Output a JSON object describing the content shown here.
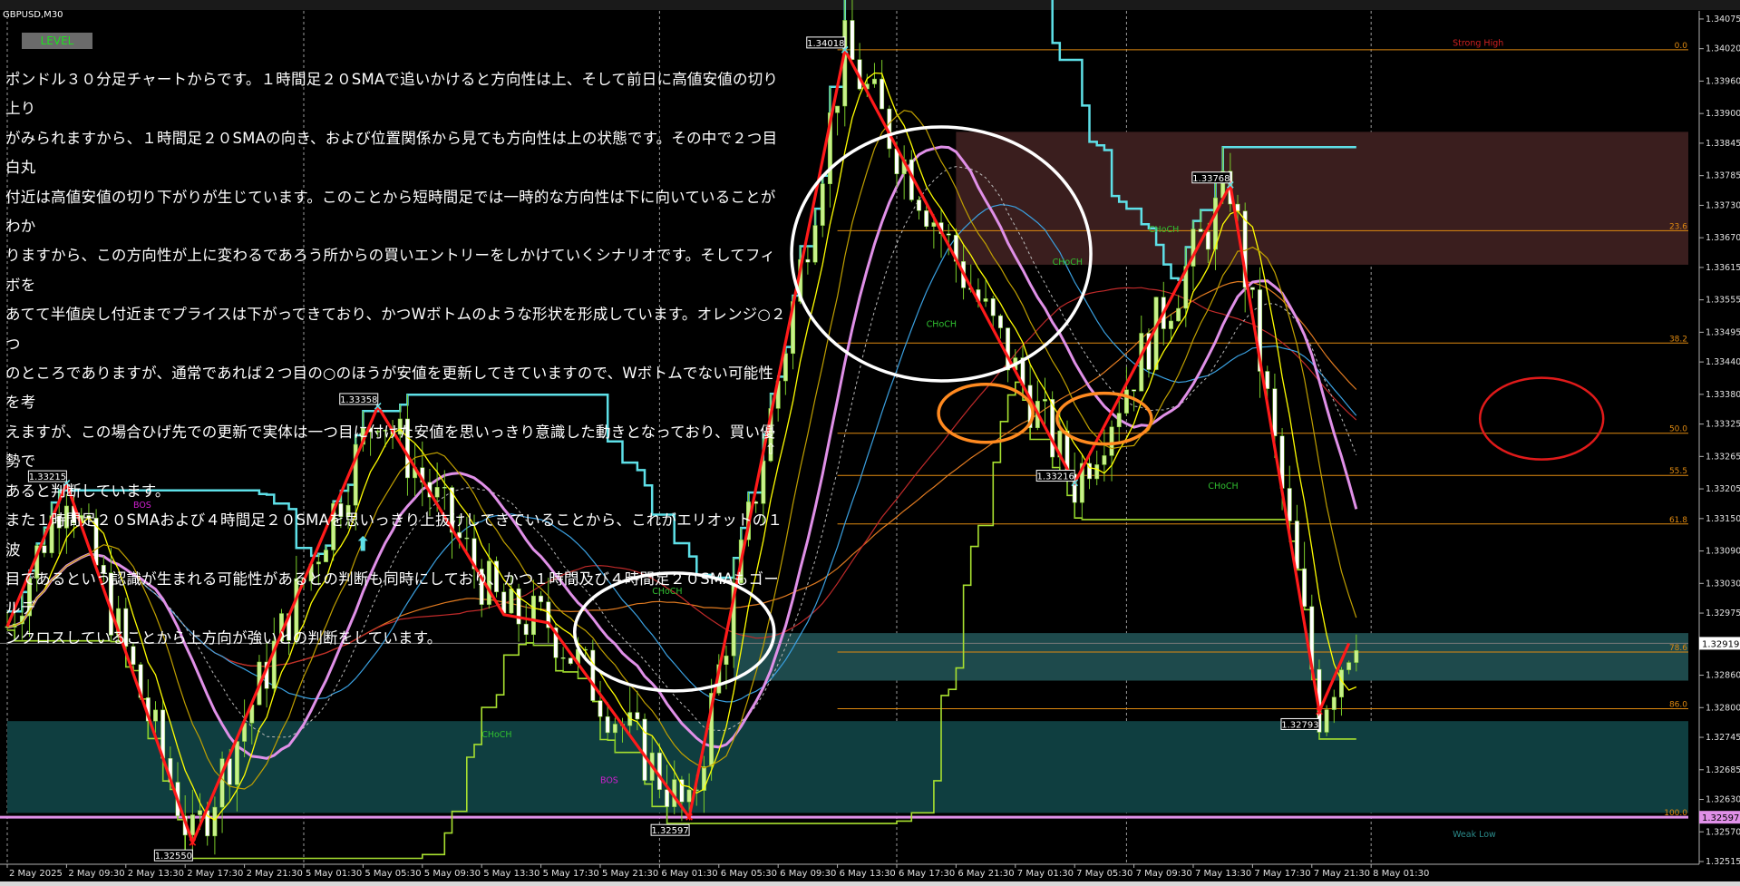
{
  "window": {
    "title": "GBPUSD,M30"
  },
  "level_button": {
    "label": "LEVEL"
  },
  "comment_lines": [
    "ポンドル３０分足チャートからです。１時間足２０SMAで追いかけると方向性は上、そして前日に高値安値の切り上り",
    "がみられますから、１時間足２０SMAの向き、および位置関係から見ても方向性は上の状態です。その中で２つ目白丸",
    "付近は高値安値の切り下がりが生じています。このことから短時間足では一時的な方向性は下に向いていることがわか",
    "りますから、この方向性が上に変わるであろう所からの買いエントリーをしかけていくシナリオです。そしてフィボを",
    "あてて半値戻し付近までプライスは下がってきており、かつWボトムのような形状を形成しています。オレンジ○２つ",
    "のところでありますが、通常であれば２つ目の○のほうが安値を更新してきていますので、Wボトムでない可能性を考",
    "えますが、この場合ひげ先での更新で実体は一つ目に付けた安値を思いっきり意識した動きとなっており、買い優勢で",
    "あると判断しています。",
    "また１時間足２０SMAおよび４時間足２０SMAを思いっきり上抜けしてきていることから、これがエリオットの１波",
    "目であるという認識が生まれる可能性があるとの判断も同時にしており、かつ１時間及び４時間足２０SMAもゴールデ",
    "ンクロスしていることから上方向が強いとの判断をしています。"
  ],
  "chart_data": {
    "type": "line",
    "symbol": "GBPUSD",
    "timeframe": "M30",
    "ylim": [
      1.3251,
      1.3409
    ],
    "x_tick_labels": [
      "2 May 2025",
      "2 May 09:30",
      "2 May 13:30",
      "2 May 17:30",
      "2 May 21:30",
      "5 May 01:30",
      "5 May 05:30",
      "5 May 09:30",
      "5 May 13:30",
      "5 May 17:30",
      "5 May 21:30",
      "6 May 01:30",
      "6 May 05:30",
      "6 May 09:30",
      "6 May 13:30",
      "6 May 17:30",
      "6 May 21:30",
      "7 May 01:30",
      "7 May 05:30",
      "7 May 09:30",
      "7 May 13:30",
      "7 May 17:30",
      "7 May 21:30",
      "8 May 01:30"
    ],
    "y_tick_labels": [
      "1.34075",
      "1.34020",
      "1.33960",
      "1.33900",
      "1.33845",
      "1.33785",
      "1.33730",
      "1.33670",
      "1.33615",
      "1.33555",
      "1.33495",
      "1.33440",
      "1.33380",
      "1.33325",
      "1.33265",
      "1.33205",
      "1.33150",
      "1.33090",
      "1.33030",
      "1.32975",
      "1.32915",
      "1.32860",
      "1.32800",
      "1.32745",
      "1.32685",
      "1.32630",
      "1.32570",
      "1.32515"
    ],
    "current_price": "1.32919",
    "current_price_value": 1.32919,
    "bottom_level_label": "1.32597",
    "zigzag": [
      {
        "i": 0,
        "p": 1.3295
      },
      {
        "i": 8,
        "p": 1.33215,
        "label": "1.33215"
      },
      {
        "i": 25,
        "p": 1.3255,
        "label": "1.32550"
      },
      {
        "i": 50,
        "p": 1.33358,
        "label": "1.33358"
      },
      {
        "i": 67,
        "p": 1.32972
      },
      {
        "i": 73,
        "p": 1.32957
      },
      {
        "i": 92,
        "p": 1.32597,
        "label": "1.32597"
      },
      {
        "i": 113,
        "p": 1.34018,
        "label": "1.34018"
      },
      {
        "i": 144,
        "p": 1.33216,
        "label": "1.33216"
      },
      {
        "i": 165,
        "p": 1.33768,
        "label": "1.33768"
      },
      {
        "i": 177,
        "p": 1.32793,
        "label": "1.32793"
      },
      {
        "i": 181,
        "p": 1.32919
      }
    ],
    "fibonacci": [
      {
        "label": "0.0",
        "price": 1.34018
      },
      {
        "label": "23.6",
        "price": 1.33683
      },
      {
        "label": "38.2",
        "price": 1.33475
      },
      {
        "label": "50.0",
        "price": 1.33308
      },
      {
        "label": "55.5",
        "price": 1.3323
      },
      {
        "label": "61.8",
        "price": 1.3314
      },
      {
        "label": "78.6",
        "price": 1.32903
      },
      {
        "label": "86.0",
        "price": 1.32798
      },
      {
        "label": "100.0",
        "price": 1.32597
      }
    ],
    "annotations": [
      {
        "text": "Strong High",
        "i": 195,
        "p": 1.34025
      },
      {
        "text": "Weak Low",
        "i": 195,
        "p": 1.3256
      },
      {
        "text": "BOS",
        "i": 17,
        "p": 1.3317
      },
      {
        "text": "BOS",
        "i": 80,
        "p": 1.3266
      },
      {
        "text": "CHoCH",
        "i": 64,
        "p": 1.32745
      },
      {
        "text": "CHoCH",
        "i": 87,
        "p": 1.3301
      },
      {
        "text": "CHoCH",
        "i": 124,
        "p": 1.33505
      },
      {
        "text": "CHoCH",
        "i": 141,
        "p": 1.3362
      },
      {
        "text": "CHoCH",
        "i": 154,
        "p": 1.3368
      },
      {
        "text": "CHoCH",
        "i": 162,
        "p": 1.33205
      }
    ],
    "zones": [
      {
        "name": "supply",
        "color": "#3a1e1e",
        "from_i": 128,
        "p_top": 1.33866,
        "p_bottom": 1.3362
      },
      {
        "name": "demand-upper",
        "color": "#1e4a4c",
        "from_i": 98,
        "p_top": 1.32938,
        "p_bottom": 1.3285
      },
      {
        "name": "demand-lower",
        "color": "#0f3e40",
        "from_i": 0,
        "p_top": 1.32775,
        "p_bottom": 1.32605
      }
    ],
    "colors": {
      "background": "#000000",
      "bull": "#c8f08a",
      "bear": "#ffffff",
      "wick": "#7acb2a",
      "zigzag": "#ff1a1a",
      "fibo": "#e08a10",
      "sma_fast": "#ffff00",
      "sma_slow": "#c0a000",
      "ma_lavender": "#e090e8",
      "ma_steel": "#3aa0e0",
      "ma_red": "#c02a2a",
      "ma_orange": "#e07a20",
      "stair_cyan": "#5ee0e8",
      "stair_lime": "#a8e030",
      "circle_white": "#ffffff",
      "circle_orange": "#ff8a20",
      "circle_red": "#e01a1a",
      "choch": "#30c030",
      "bos_magenta": "#d020d0"
    }
  }
}
